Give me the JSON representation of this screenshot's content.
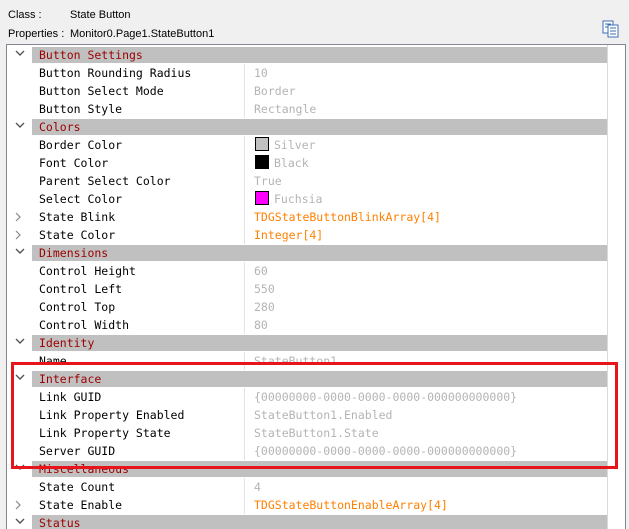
{
  "header": {
    "class_key": "Class :",
    "class_value": "State Button",
    "properties_key": "Properties :",
    "properties_value": "Monitor0.Page1.StateButton1",
    "copy_icon": "copy-to-clipboard-icon"
  },
  "colors": {
    "category_bar": "#c0c0c0",
    "category_text": "#9b0000",
    "value_disabled": "#b4b4b4",
    "value_link": "#ff8000",
    "highlight_box": "#e8141c"
  },
  "rows": [
    {
      "type": "category",
      "label": "Button Settings",
      "expanded": true
    },
    {
      "type": "prop",
      "name": "Button Rounding Radius",
      "value": "10"
    },
    {
      "type": "prop",
      "name": "Button Select Mode",
      "value": "Border"
    },
    {
      "type": "prop",
      "name": "Button Style",
      "value": "Rectangle"
    },
    {
      "type": "category",
      "label": "Colors",
      "expanded": true
    },
    {
      "type": "prop",
      "name": "Border Color",
      "value": "Silver",
      "swatch": "#c0c0c0"
    },
    {
      "type": "prop",
      "name": "Font Color",
      "value": "Black",
      "swatch": "#000000"
    },
    {
      "type": "prop",
      "name": "Parent Select Color",
      "value": "True"
    },
    {
      "type": "prop",
      "name": "Select Color",
      "value": "Fuchsia",
      "swatch": "#ff00ff"
    },
    {
      "type": "prop",
      "name": "State Blink",
      "value": "TDGStateButtonBlinkArray[4]",
      "link": true,
      "expander": "collapsed"
    },
    {
      "type": "prop",
      "name": "State Color",
      "value": "Integer[4]",
      "link": true,
      "expander": "collapsed"
    },
    {
      "type": "category",
      "label": "Dimensions",
      "expanded": true
    },
    {
      "type": "prop",
      "name": "Control Height",
      "value": "60"
    },
    {
      "type": "prop",
      "name": "Control Left",
      "value": "550"
    },
    {
      "type": "prop",
      "name": "Control Top",
      "value": "280"
    },
    {
      "type": "prop",
      "name": "Control Width",
      "value": "80"
    },
    {
      "type": "category",
      "label": "Identity",
      "expanded": true
    },
    {
      "type": "prop",
      "name": "Name",
      "value": "StateButton1"
    },
    {
      "type": "category",
      "label": "Interface",
      "expanded": true
    },
    {
      "type": "prop",
      "name": "Link GUID",
      "value": "{00000000-0000-0000-0000-000000000000}"
    },
    {
      "type": "prop",
      "name": "Link Property Enabled",
      "value": "StateButton1.Enabled"
    },
    {
      "type": "prop",
      "name": "Link Property State",
      "value": "StateButton1.State"
    },
    {
      "type": "prop",
      "name": "Server GUID",
      "value": "{00000000-0000-0000-0000-000000000000}"
    },
    {
      "type": "category",
      "label": "Miscellaneous",
      "expanded": true
    },
    {
      "type": "prop",
      "name": "State Count",
      "value": "4"
    },
    {
      "type": "prop",
      "name": "State Enable",
      "value": "TDGStateButtonEnableArray[4]",
      "link": true,
      "expander": "collapsed"
    },
    {
      "type": "category",
      "label": "Status",
      "expanded": true
    }
  ]
}
